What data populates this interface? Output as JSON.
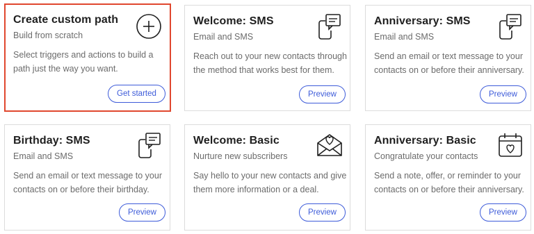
{
  "cards": [
    {
      "title": "Create custom path",
      "subtitle": "Build from scratch",
      "description": "Select triggers and actions to build a path just the way you want.",
      "button": "Get started",
      "icon": "plus-circle-icon"
    },
    {
      "title": "Welcome: SMS",
      "subtitle": "Email and SMS",
      "description": "Reach out to your new contacts through the method that works best for them.",
      "button": "Preview",
      "icon": "phone-message-icon"
    },
    {
      "title": "Anniversary: SMS",
      "subtitle": "Email and SMS",
      "description": "Send an email or text message to your contacts on or before their anniversary.",
      "button": "Preview",
      "icon": "phone-message-icon"
    },
    {
      "title": "Birthday: SMS",
      "subtitle": "Email and SMS",
      "description": "Send an email or text message to your contacts on or before their birthday.",
      "button": "Preview",
      "icon": "phone-message-icon"
    },
    {
      "title": "Welcome: Basic",
      "subtitle": "Nurture new subscribers",
      "description": "Say hello to your new contacts and give them more information or a deal.",
      "button": "Preview",
      "icon": "envelope-heart-icon"
    },
    {
      "title": "Anniversary: Basic",
      "subtitle": "Congratulate your contacts",
      "description": "Send a note, offer, or reminder to your contacts on or before their anniversary.",
      "button": "Preview",
      "icon": "calendar-heart-icon"
    }
  ],
  "colors": {
    "accent": "#3d5bd9",
    "highlight": "#e0472e",
    "text": "#1f1f1f",
    "muted": "#6b6b6b",
    "border": "#dcdcdc"
  }
}
